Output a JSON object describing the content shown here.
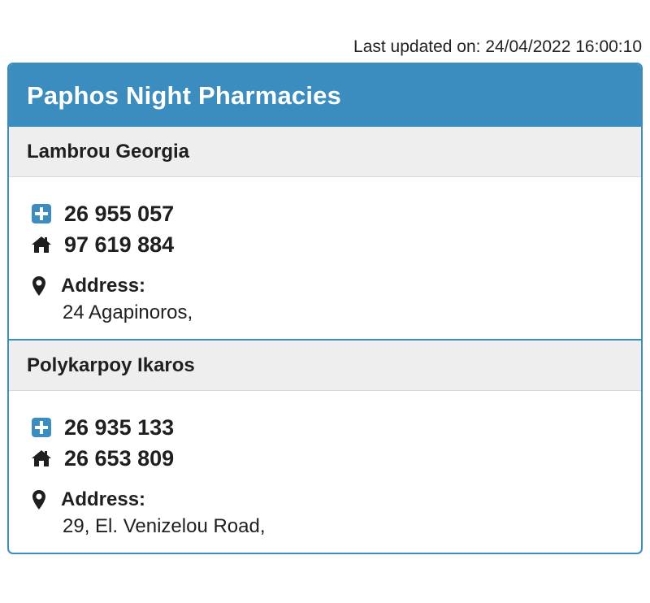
{
  "header": {
    "last_updated": "Last updated on: 24/04/2022 16:00:10"
  },
  "panel": {
    "title": "Paphos Night Pharmacies"
  },
  "pharmacies": [
    {
      "name": "Lambrou Georgia",
      "work_phone": "26 955 057",
      "home_phone": "97 619 884",
      "address_label": "Address:",
      "address": "24 Agapinoros,"
    },
    {
      "name": "Polykarpoy Ikaros",
      "work_phone": "26 935 133",
      "home_phone": "26 653 809",
      "address_label": "Address:",
      "address": "29, El. Venizelou Road,"
    }
  ],
  "icons": {
    "pharmacy": "plus-square-icon",
    "home": "home-icon",
    "location": "map-marker-icon"
  },
  "colors": {
    "accent": "#3c8dbf",
    "name_background": "#eeeeee",
    "text": "#1f1f1f"
  }
}
